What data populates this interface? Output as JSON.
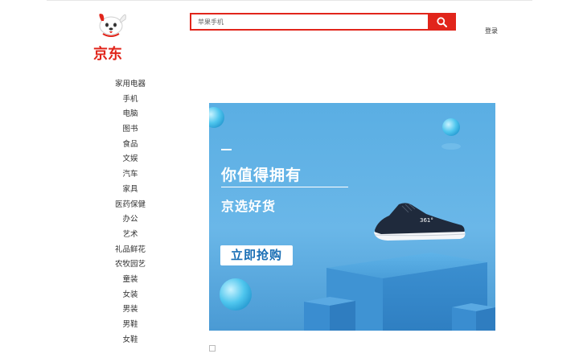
{
  "logo": {
    "text": "京东",
    "icon": "jd-dog-mascot-icon",
    "color": "#e1251b"
  },
  "search": {
    "placeholder": "苹果手机",
    "button_icon": "search-icon",
    "accent": "#e1251b"
  },
  "header": {
    "login_label": "登录"
  },
  "categories": [
    "家用电器",
    "手机",
    "电脑",
    "图书",
    "食品",
    "文娱",
    "汽车",
    "家具",
    "医药保健",
    "办公",
    "艺术",
    "礼品鲜花",
    "农牧园艺",
    "童装",
    "女装",
    "男装",
    "男鞋",
    "女鞋"
  ],
  "banner": {
    "headline": "你值得拥有",
    "subheadline": "京选好货",
    "cta_label": "立即抢购",
    "product_brand": "361°",
    "product_icon": "sneaker-image",
    "background": "#5aaee3"
  },
  "carousel": {
    "indicator_count": 1
  }
}
